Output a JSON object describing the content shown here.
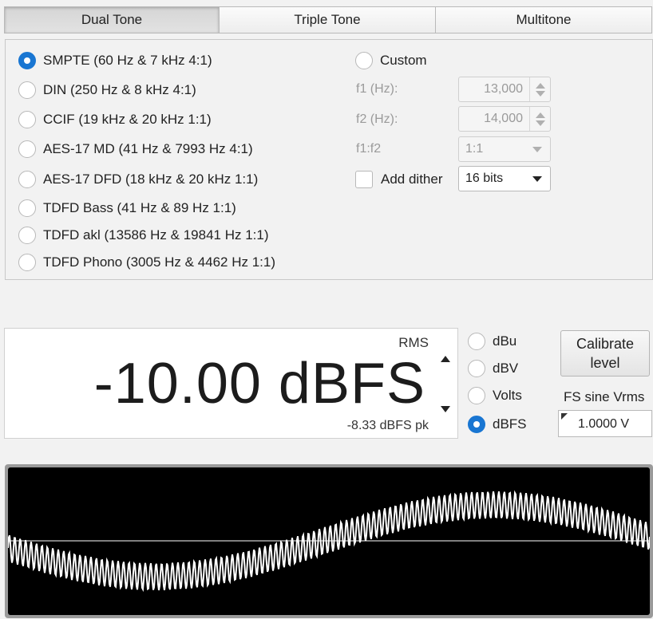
{
  "tabs": [
    {
      "label": "Dual Tone",
      "active": true
    },
    {
      "label": "Triple Tone",
      "active": false
    },
    {
      "label": "Multitone",
      "active": false
    }
  ],
  "presets": [
    {
      "label": "SMPTE (60 Hz & 7 kHz 4:1)",
      "checked": true
    },
    {
      "label": "DIN (250 Hz & 8 kHz 4:1)",
      "checked": false
    },
    {
      "label": "CCIF (19 kHz & 20 kHz 1:1)",
      "checked": false
    },
    {
      "label": "AES-17 MD (41 Hz & 7993 Hz 4:1)",
      "checked": false
    },
    {
      "label": "AES-17 DFD (18 kHz & 20 kHz 1:1)",
      "checked": false
    },
    {
      "label": "TDFD Bass (41 Hz & 89 Hz 1:1)",
      "checked": false
    },
    {
      "label": "TDFD akl (13586 Hz & 19841 Hz 1:1)",
      "checked": false
    },
    {
      "label": "TDFD Phono (3005 Hz & 4462 Hz 1:1)",
      "checked": false
    }
  ],
  "custom": {
    "label": "Custom",
    "f1_label": "f1 (Hz):",
    "f1_value": "13,000",
    "f2_label": "f2 (Hz):",
    "f2_value": "14,000",
    "ratio_label": "f1:f2",
    "ratio_value": "1:1"
  },
  "dither": {
    "label": "Add dither",
    "checked": false,
    "bits_value": "16 bits"
  },
  "level": {
    "mode": "RMS",
    "value": "-10.00 dBFS",
    "peak": "-8.33 dBFS pk"
  },
  "units": [
    {
      "label": "dBu",
      "checked": false
    },
    {
      "label": "dBV",
      "checked": false
    },
    {
      "label": "Volts",
      "checked": false
    },
    {
      "label": "dBFS",
      "checked": true
    }
  ],
  "calibrate": {
    "label_line1": "Calibrate",
    "label_line2": "level",
    "fs_label": "FS sine Vrms",
    "fs_value": "1.0000 V"
  },
  "scope": {
    "background": "#000000",
    "trace_color": "#ffffff"
  }
}
